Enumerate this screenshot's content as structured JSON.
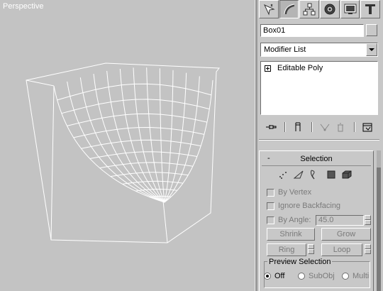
{
  "viewport": {
    "label": "Perspective"
  },
  "tabs": [
    {
      "name": "create-tab-icon"
    },
    {
      "name": "modify-tab-icon"
    },
    {
      "name": "hierarchy-tab-icon"
    },
    {
      "name": "motion-tab-icon"
    },
    {
      "name": "display-tab-icon"
    },
    {
      "name": "utilities-tab-icon"
    }
  ],
  "object_name": "Box01",
  "modifier_list": {
    "selected": "Modifier List"
  },
  "stack": {
    "items": [
      {
        "label": "Editable Poly"
      }
    ]
  },
  "selection_rollout": {
    "collapse_symbol": "-",
    "title": "Selection",
    "by_vertex": "By Vertex",
    "ignore_backfacing": "Ignore Backfacing",
    "by_angle": "By Angle:",
    "angle_value": "45.0",
    "shrink": "Shrink",
    "grow": "Grow",
    "ring": "Ring",
    "loop": "Loop",
    "preview_selection": {
      "title": "Preview Selection",
      "options": [
        "Off",
        "SubObj",
        "Multi"
      ],
      "selected": "Off"
    }
  },
  "colors": {
    "viewport_bg": "#c3c3c3",
    "wire": "#ffffff",
    "panel_bg": "#c8c8c8",
    "disabled_text": "#7a7a7a"
  }
}
